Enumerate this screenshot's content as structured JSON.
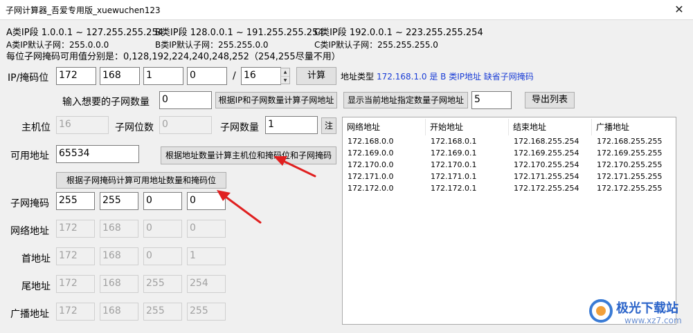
{
  "window": {
    "title": "子网计算器_吾爱专用版_xuewuchen123",
    "close_glyph": "✕"
  },
  "info": {
    "line_a": "A类IP段 1.0.0.1 ~ 127.255.255.254",
    "line_b": "B类IP段 128.0.0.1 ~ 191.255.255.254",
    "line_c": "C类IP段 192.0.0.1 ~ 223.255.255.254",
    "mask_a": "A类IP默认子网：255.0.0.0",
    "mask_b": "B类IP默认子网：255.255.0.0",
    "mask_c": "C类IP默认子网：255.255.255.0",
    "mask_values": "每位子网掩码可用值分别是：0,128,192,224,240,248,252（254,255尽量不用）"
  },
  "ip_row": {
    "label": "IP/掩码位",
    "octets": [
      "172",
      "168",
      "1",
      "0"
    ],
    "slash": "/",
    "prefix": "16",
    "spin_up": "▲",
    "spin_down": "▼",
    "calc_button": "计算",
    "type_label": "地址类型",
    "type_value": "172.168.1.0 是 B 类IP地址 缺省子网掩码"
  },
  "subnet_count": {
    "label": "输入想要的子网数量",
    "value": "0",
    "calc_by_ip_button": "根据IP和子网数量计算子网地址",
    "show_button": "显示当前地址指定数量子网地址",
    "show_count": "5",
    "export_button": "导出列表"
  },
  "bits": {
    "host_label": "主机位",
    "host_value": "16",
    "subnet_bits_label": "子网位数",
    "subnet_bits_value": "0",
    "subnet_num_label": "子网数量",
    "subnet_num_value": "1",
    "note_button": "注"
  },
  "usable": {
    "label": "可用地址",
    "value": "65534",
    "calc_host_button": "根据地址数量计算主机位和掩码位和子网掩码",
    "calc_mask_button": "根据子网掩码计算可用地址数量和掩码位"
  },
  "addresses": {
    "mask": {
      "label": "子网掩码",
      "values": [
        "255",
        "255",
        "0",
        "0"
      ]
    },
    "network": {
      "label": "网络地址",
      "values": [
        "172",
        "168",
        "0",
        "0"
      ]
    },
    "first": {
      "label": "首地址",
      "values": [
        "172",
        "168",
        "0",
        "1"
      ]
    },
    "last": {
      "label": "尾地址",
      "values": [
        "172",
        "168",
        "255",
        "254"
      ]
    },
    "broadcast": {
      "label": "广播地址",
      "values": [
        "172",
        "168",
        "255",
        "255"
      ]
    }
  },
  "table": {
    "headers": [
      "网络地址",
      "开始地址",
      "结束地址",
      "广播地址"
    ],
    "rows": [
      [
        "172.168.0.0",
        "172.168.0.1",
        "172.168.255.254",
        "172.168.255.255"
      ],
      [
        "172.169.0.0",
        "172.169.0.1",
        "172.169.255.254",
        "172.169.255.255"
      ],
      [
        "172.170.0.0",
        "172.170.0.1",
        "172.170.255.254",
        "172.170.255.255"
      ],
      [
        "172.171.0.0",
        "172.171.0.1",
        "172.171.255.254",
        "172.171.255.255"
      ],
      [
        "172.172.0.0",
        "172.172.0.1",
        "172.172.255.254",
        "172.172.255.255"
      ]
    ]
  },
  "watermark": {
    "brand": "极光下载站",
    "url": "www.xz7.com"
  },
  "colors": {
    "accent_blue": "#1a3dd6",
    "arrow_red": "#e02020",
    "window_bg": "#f0f0f0"
  }
}
